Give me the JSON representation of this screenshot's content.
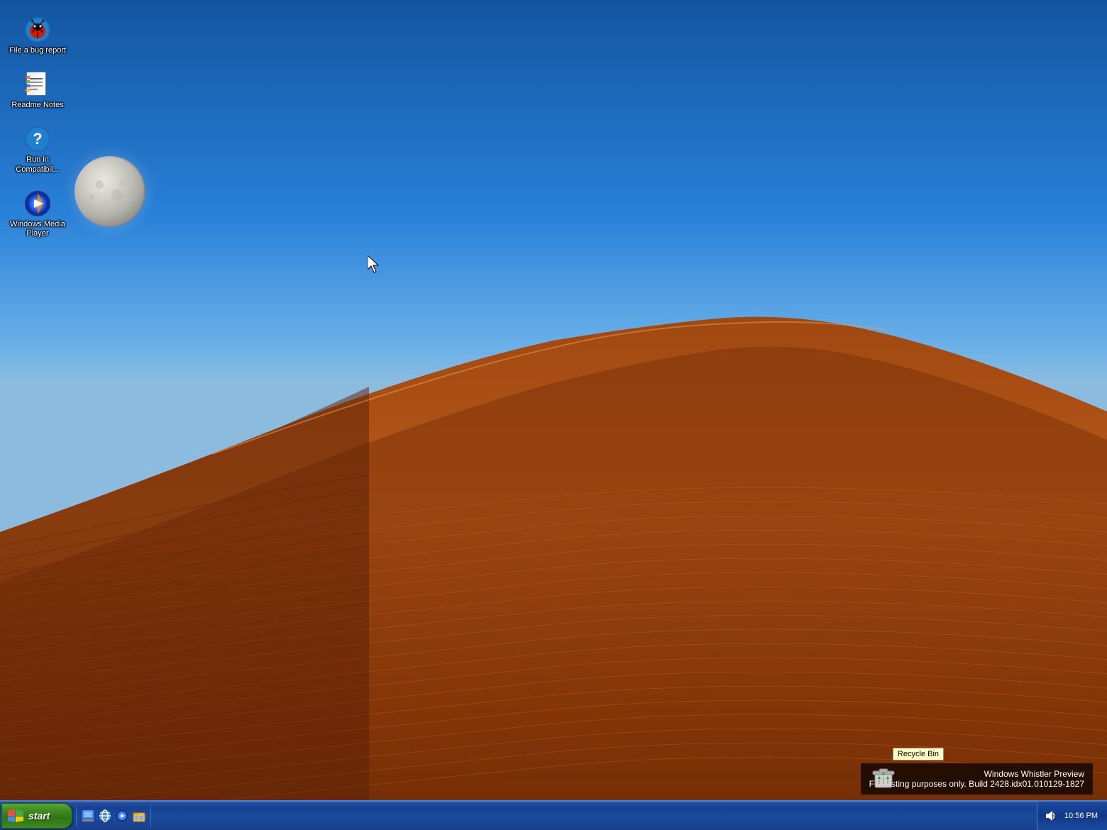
{
  "desktop": {
    "icons": [
      {
        "id": "file-bug-report",
        "label": "File a bug report",
        "type": "bug"
      },
      {
        "id": "readme-notes",
        "label": "Readme Notes",
        "type": "readme"
      },
      {
        "id": "run-compat",
        "label": "Run in Compatibil...",
        "type": "compat"
      },
      {
        "id": "windows-media-player",
        "label": "Windows Media Player",
        "type": "wmp"
      }
    ]
  },
  "taskbar": {
    "start_label": "start",
    "quick_launch": [
      {
        "id": "show-desktop",
        "label": "Show Desktop"
      },
      {
        "id": "ie",
        "label": "Internet Explorer"
      },
      {
        "id": "media-player",
        "label": "Windows Media Player"
      },
      {
        "id": "windows-explorer",
        "label": "Windows Explorer"
      }
    ],
    "clock": "10:56 PM"
  },
  "notification": {
    "title": "Windows Whistler Preview",
    "subtitle": "For testing purposes only. Build 2428.idx01.010129-1827"
  },
  "recycle_bin": {
    "label": "Recycle Bin"
  }
}
